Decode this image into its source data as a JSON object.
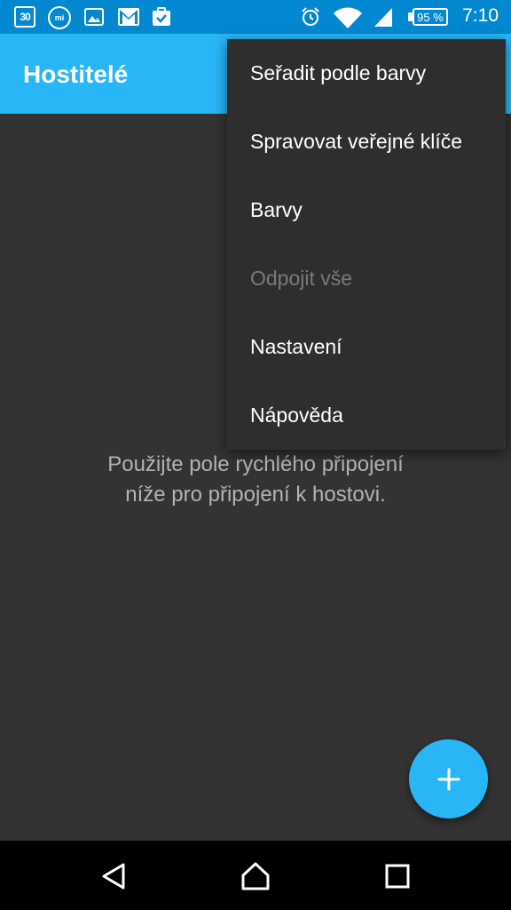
{
  "status_bar": {
    "calendar_day": "30",
    "mi_label": "mi",
    "battery_percent": "95 %",
    "time": "7:10",
    "icons": [
      "calendar-icon",
      "mi-fit-icon",
      "gallery-icon",
      "gmail-icon",
      "task-icon",
      "alarm-icon",
      "wifi-icon",
      "signal-icon",
      "battery-icon"
    ]
  },
  "app_bar": {
    "title": "Hostitelé"
  },
  "menu": {
    "items": [
      {
        "label": "Seřadit podle barvy",
        "enabled": true
      },
      {
        "label": "Spravovat veřejné klíče",
        "enabled": true
      },
      {
        "label": "Barvy",
        "enabled": true
      },
      {
        "label": "Odpojit vše",
        "enabled": false
      },
      {
        "label": "Nastavení",
        "enabled": true
      },
      {
        "label": "Nápověda",
        "enabled": true
      }
    ]
  },
  "empty_message": {
    "line1": "Použijte pole rychlého připojení",
    "line2": "níže pro připojení k hostovi."
  },
  "fab": {
    "icon": "plus-icon"
  },
  "nav_bar": {
    "icons": [
      "back-icon",
      "home-icon",
      "recents-icon"
    ]
  },
  "colors": {
    "app_bar": "#29b6f6",
    "status_bar": "#0288d1",
    "background": "#333333",
    "menu_background": "#2e2e2e",
    "fab": "#29b6f6"
  }
}
